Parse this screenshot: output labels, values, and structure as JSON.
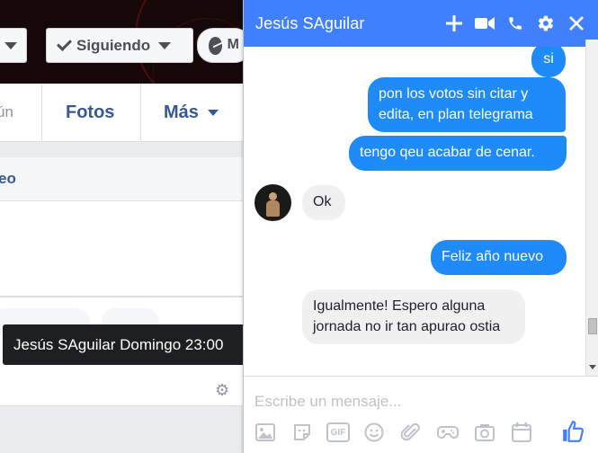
{
  "profile": {
    "follow_label": "Siguiendo",
    "message_label": "M",
    "nav_partial": "ún",
    "nav_photos": "Fotos",
    "nav_more": "Más",
    "card_head": "eo"
  },
  "tooltip": "Jesús SAguilar Domingo 23:00",
  "chat": {
    "title": "Jesús SAguilar",
    "header_icons": [
      "plus-icon",
      "video-icon",
      "phone-icon",
      "gear-icon",
      "close-icon"
    ],
    "messages": [
      {
        "from": "me",
        "text": "si"
      },
      {
        "from": "me",
        "text": "pon los votos sin citar y edita, en plan telegrama"
      },
      {
        "from": "me",
        "text": "tengo qeu acabar de cenar."
      },
      {
        "from": "them",
        "text": "Ok"
      },
      {
        "from": "me",
        "text": "Feliz año nuevo"
      },
      {
        "from": "them",
        "text": "Igualmente! Espero alguna jornada no ir tan apurao ostia"
      }
    ],
    "composer": {
      "placeholder": "Escribe un mensaje...",
      "tools": [
        "image-icon",
        "sticker-icon",
        "gif-icon",
        "emoji-icon",
        "attachment-icon",
        "game-icon",
        "camera-icon",
        "calendar-icon"
      ],
      "gif_label": "GIF"
    },
    "colors": {
      "header": "#4080ff",
      "outgoing": "#1e8bf8",
      "incoming": "#f1f0f0"
    }
  }
}
